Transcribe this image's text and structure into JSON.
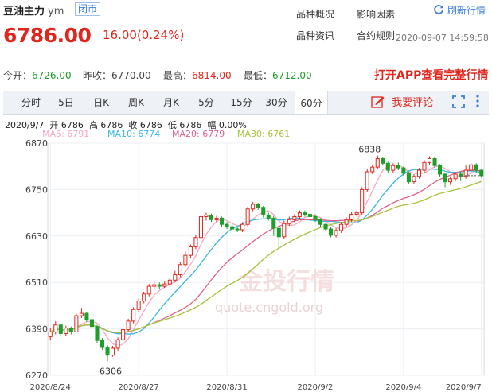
{
  "header": {
    "name": "豆油主力",
    "code": "ym",
    "status": "闭市",
    "price": "6786.00",
    "change": "16.00(0.24%)",
    "links": [
      "品种概况",
      "影响因素",
      "品种资讯",
      "合约规则"
    ],
    "refresh_label": "刷新行情",
    "datetime": "2020-09-07 14:59:58"
  },
  "stats": {
    "open_label": "今开：",
    "open": "6726.00",
    "prev_label": "昨收：",
    "prev": "6770.00",
    "high_label": "最高：",
    "high": "6814.00",
    "low_label": "最低：",
    "low": "6712.00",
    "app_cta": "打开APP查看完整行情"
  },
  "tabs": [
    {
      "label": "分时",
      "active": false
    },
    {
      "label": "5日",
      "active": false
    },
    {
      "label": "日K",
      "active": false
    },
    {
      "label": "周K",
      "active": false
    },
    {
      "label": "月K",
      "active": false
    },
    {
      "label": "5分",
      "active": false
    },
    {
      "label": "15分",
      "active": false
    },
    {
      "label": "30分",
      "active": false
    },
    {
      "label": "60分",
      "active": true
    }
  ],
  "comment_label": "我要评论",
  "info_bar": "2020/9/7  开 6786  高 6786  收 6786  低 6786  幅 0.00%",
  "ma_legend": [
    {
      "label": "MA5: 6791",
      "color": "#f5a6c2"
    },
    {
      "label": "MA10: 6774",
      "color": "#3cb7e0"
    },
    {
      "label": "MA20: 6779",
      "color": "#e0608a"
    },
    {
      "label": "MA30: 6761",
      "color": "#a8c23c"
    }
  ],
  "watermark": {
    "cn": "金投行情",
    "url": "quote.cngold.org"
  },
  "chart_data": {
    "type": "candlestick",
    "ylim": [
      6270,
      6870
    ],
    "y_ticks": [
      6870,
      6750,
      6630,
      6510,
      6390,
      6270
    ],
    "x_ticks": [
      "2020/8/24",
      "2020/8/27",
      "2020/8/31",
      "2020/9/2",
      "2020/9/4",
      "2020/9/7"
    ],
    "annotations": [
      {
        "label": "6838",
        "value": 6838
      },
      {
        "label": "6306",
        "value": 6306
      }
    ],
    "colors": {
      "up": "#e0261c",
      "down": "#1f9e2c"
    },
    "candles": [
      [
        6370,
        6382,
        6392,
        6360
      ],
      [
        6382,
        6400,
        6410,
        6376
      ],
      [
        6400,
        6378,
        6404,
        6372
      ],
      [
        6378,
        6392,
        6398,
        6372
      ],
      [
        6392,
        6382,
        6396,
        6376
      ],
      [
        6382,
        6424,
        6430,
        6380
      ],
      [
        6424,
        6430,
        6444,
        6418
      ],
      [
        6430,
        6414,
        6434,
        6408
      ],
      [
        6414,
        6396,
        6420,
        6390
      ],
      [
        6396,
        6360,
        6400,
        6352
      ],
      [
        6360,
        6342,
        6366,
        6336
      ],
      [
        6342,
        6322,
        6348,
        6306
      ],
      [
        6322,
        6340,
        6346,
        6318
      ],
      [
        6340,
        6362,
        6368,
        6334
      ],
      [
        6362,
        6388,
        6394,
        6356
      ],
      [
        6388,
        6410,
        6416,
        6382
      ],
      [
        6410,
        6440,
        6446,
        6404
      ],
      [
        6440,
        6462,
        6468,
        6434
      ],
      [
        6462,
        6480,
        6486,
        6456
      ],
      [
        6480,
        6500,
        6506,
        6474
      ],
      [
        6500,
        6504,
        6512,
        6494
      ],
      [
        6504,
        6500,
        6510,
        6494
      ],
      [
        6500,
        6506,
        6514,
        6496
      ],
      [
        6506,
        6516,
        6522,
        6500
      ],
      [
        6516,
        6530,
        6540,
        6510
      ],
      [
        6530,
        6556,
        6562,
        6524
      ],
      [
        6556,
        6580,
        6590,
        6550
      ],
      [
        6580,
        6602,
        6608,
        6574
      ],
      [
        6602,
        6626,
        6632,
        6596
      ],
      [
        6626,
        6680,
        6686,
        6620
      ],
      [
        6680,
        6684,
        6690,
        6670
      ],
      [
        6684,
        6672,
        6688,
        6666
      ],
      [
        6672,
        6676,
        6682,
        6666
      ],
      [
        6676,
        6660,
        6680,
        6654
      ],
      [
        6660,
        6654,
        6666,
        6648
      ],
      [
        6654,
        6648,
        6660,
        6642
      ],
      [
        6648,
        6646,
        6654,
        6640
      ],
      [
        6646,
        6660,
        6666,
        6640
      ],
      [
        6660,
        6700,
        6706,
        6654
      ],
      [
        6700,
        6712,
        6718,
        6694
      ],
      [
        6712,
        6704,
        6716,
        6698
      ],
      [
        6704,
        6684,
        6708,
        6678
      ],
      [
        6684,
        6676,
        6690,
        6670
      ],
      [
        6676,
        6650,
        6682,
        6630
      ],
      [
        6650,
        6628,
        6656,
        6596
      ],
      [
        6628,
        6662,
        6670,
        6622
      ],
      [
        6662,
        6672,
        6680,
        6656
      ],
      [
        6672,
        6680,
        6686,
        6666
      ],
      [
        6680,
        6690,
        6696,
        6674
      ],
      [
        6690,
        6686,
        6696,
        6680
      ],
      [
        6686,
        6680,
        6692,
        6674
      ],
      [
        6680,
        6672,
        6686,
        6666
      ],
      [
        6672,
        6660,
        6676,
        6654
      ],
      [
        6660,
        6648,
        6664,
        6642
      ],
      [
        6648,
        6632,
        6654,
        6626
      ],
      [
        6632,
        6644,
        6650,
        6626
      ],
      [
        6644,
        6660,
        6666,
        6638
      ],
      [
        6660,
        6672,
        6678,
        6654
      ],
      [
        6672,
        6686,
        6692,
        6666
      ],
      [
        6686,
        6690,
        6696,
        6680
      ],
      [
        6690,
        6750,
        6756,
        6684
      ],
      [
        6750,
        6796,
        6804,
        6744
      ],
      [
        6796,
        6808,
        6814,
        6790
      ],
      [
        6808,
        6830,
        6838,
        6802
      ],
      [
        6830,
        6818,
        6834,
        6812
      ],
      [
        6818,
        6800,
        6822,
        6794
      ],
      [
        6800,
        6812,
        6818,
        6794
      ],
      [
        6812,
        6806,
        6820,
        6800
      ],
      [
        6806,
        6792,
        6810,
        6786
      ],
      [
        6792,
        6770,
        6796,
        6764
      ],
      [
        6770,
        6784,
        6790,
        6764
      ],
      [
        6784,
        6800,
        6806,
        6778
      ],
      [
        6800,
        6820,
        6826,
        6794
      ],
      [
        6820,
        6830,
        6836,
        6814
      ],
      [
        6830,
        6812,
        6834,
        6806
      ],
      [
        6812,
        6790,
        6816,
        6784
      ],
      [
        6790,
        6770,
        6794,
        6756
      ],
      [
        6770,
        6778,
        6784,
        6762
      ],
      [
        6778,
        6790,
        6796,
        6772
      ],
      [
        6790,
        6784,
        6796,
        6772
      ],
      [
        6784,
        6800,
        6812,
        6778
      ],
      [
        6800,
        6814,
        6818,
        6794
      ],
      [
        6814,
        6800,
        6818,
        6794
      ],
      [
        6800,
        6786,
        6804,
        6780
      ]
    ]
  }
}
